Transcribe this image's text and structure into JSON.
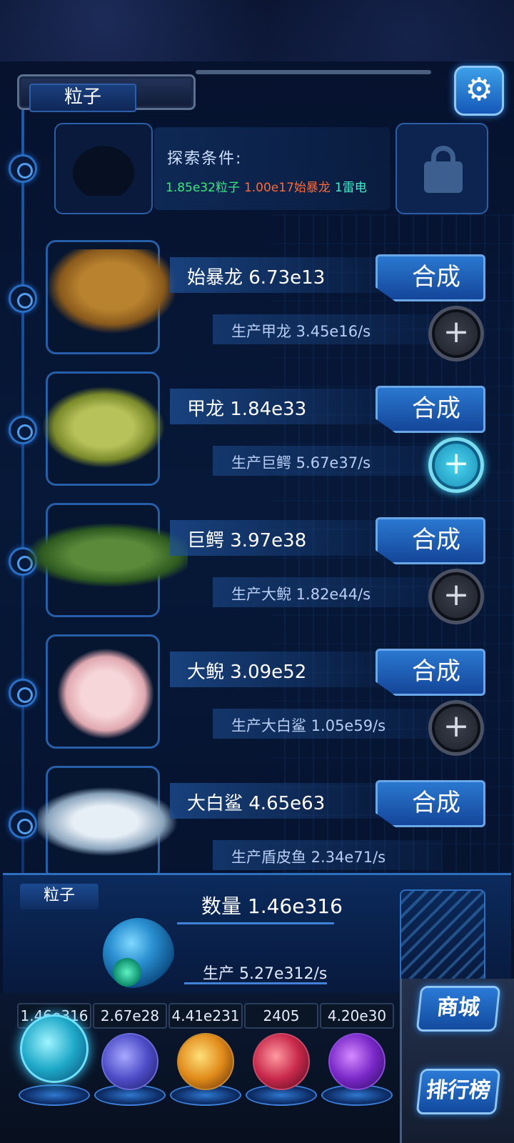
{
  "header": {
    "currency_label": "粒子",
    "settings_icon": "gear-icon"
  },
  "explore": {
    "title": "探索条件:",
    "req_particles": "1.85e32粒子",
    "req_trex": "1.00e17始暴龙",
    "req_thunder": "1雷电",
    "lock_icon": "lock-icon"
  },
  "creatures": [
    {
      "name": "始暴龙 6.73e13",
      "production": "生产甲龙 3.45e16/s",
      "combine_label": "合成",
      "plus_active": false
    },
    {
      "name": "甲龙 1.84e33",
      "production": "生产巨鳄 5.67e37/s",
      "combine_label": "合成",
      "plus_active": true
    },
    {
      "name": "巨鳄 3.97e38",
      "production": "生产大鲵 1.82e44/s",
      "combine_label": "合成",
      "plus_active": false
    },
    {
      "name": "大鲵 3.09e52",
      "production": "生产大白鲨 1.05e59/s",
      "combine_label": "合成",
      "plus_active": false
    },
    {
      "name": "大白鲨 4.65e63",
      "production": "生产盾皮鱼 2.34e71/s",
      "combine_label": "合成",
      "plus_active": false
    }
  ],
  "stats": {
    "tag": "粒子",
    "quantity": "数量 1.46e316",
    "production": "生产 5.27e312/s"
  },
  "resources": [
    {
      "value": "1.46e316",
      "icon": "particle-orb-icon"
    },
    {
      "value": "2.67e28",
      "icon": "lightning-orb-icon"
    },
    {
      "value": "4.41e231",
      "icon": "fire-orb-icon"
    },
    {
      "value": "2405",
      "icon": "brain-orb-icon"
    },
    {
      "value": "4.20e30",
      "icon": "vortex-orb-icon"
    }
  ],
  "side": {
    "shop_label": "商城",
    "rank_label": "排行榜"
  },
  "colors": {
    "accent": "#2a78d0",
    "req_green": "#39ea7a",
    "req_orange": "#ff6a36",
    "req_cyan": "#3ff0c8"
  }
}
